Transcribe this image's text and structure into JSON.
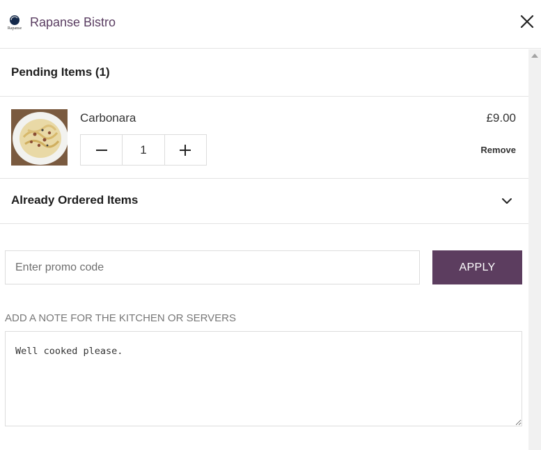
{
  "header": {
    "brand_name": "Rapanse Bistro",
    "logo_text": "Rapanse",
    "close_icon": "close-icon"
  },
  "pending": {
    "title": "Pending Items (1)",
    "items": [
      {
        "name": "Carbonara",
        "price": "£9.00",
        "quantity": "1",
        "remove_label": "Remove",
        "image": "carbonara-pasta-photo"
      }
    ]
  },
  "already_ordered": {
    "title": "Already Ordered Items",
    "toggle_icon": "chevron-down-icon"
  },
  "promo": {
    "placeholder": "Enter promo code",
    "value": "",
    "apply_label": "APPLY"
  },
  "note": {
    "label": "ADD A NOTE FOR THE KITCHEN OR SERVERS",
    "value": "Well cooked please."
  },
  "colors": {
    "brand": "#5a3d61",
    "apply_button": "#5c3d5f",
    "divider": "#e3e3e3"
  }
}
